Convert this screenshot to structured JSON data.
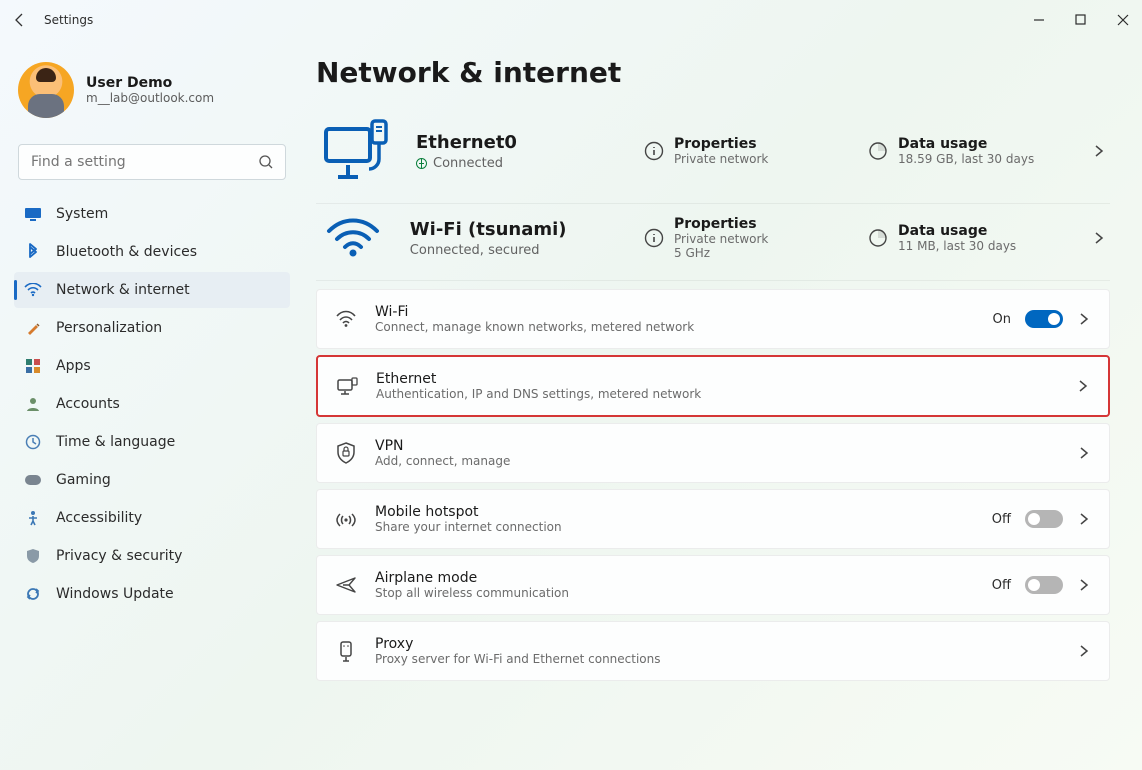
{
  "app": {
    "title": "Settings"
  },
  "user": {
    "name": "User Demo",
    "email": "m__lab@outlook.com"
  },
  "search": {
    "placeholder": "Find a setting"
  },
  "nav": [
    {
      "label": "System"
    },
    {
      "label": "Bluetooth & devices"
    },
    {
      "label": "Network & internet"
    },
    {
      "label": "Personalization"
    },
    {
      "label": "Apps"
    },
    {
      "label": "Accounts"
    },
    {
      "label": "Time & language"
    },
    {
      "label": "Gaming"
    },
    {
      "label": "Accessibility"
    },
    {
      "label": "Privacy & security"
    },
    {
      "label": "Windows Update"
    }
  ],
  "page": {
    "title": "Network & internet"
  },
  "connections": [
    {
      "name": "Ethernet0",
      "status": "Connected",
      "properties": {
        "head": "Properties",
        "sub": "Private network"
      },
      "usage": {
        "head": "Data usage",
        "sub": "18.59 GB, last 30 days"
      }
    },
    {
      "name": "Wi-Fi (tsunami)",
      "status": "Connected, secured",
      "properties": {
        "head": "Properties",
        "sub": "Private network\n5 GHz"
      },
      "usage": {
        "head": "Data usage",
        "sub": "11 MB, last 30 days"
      }
    }
  ],
  "cards": [
    {
      "title": "Wi-Fi",
      "sub": "Connect, manage known networks, metered network",
      "state": "On",
      "toggle": true
    },
    {
      "title": "Ethernet",
      "sub": "Authentication, IP and DNS settings, metered network"
    },
    {
      "title": "VPN",
      "sub": "Add, connect, manage"
    },
    {
      "title": "Mobile hotspot",
      "sub": "Share your internet connection",
      "state": "Off",
      "toggle": false
    },
    {
      "title": "Airplane mode",
      "sub": "Stop all wireless communication",
      "state": "Off",
      "toggle": false
    },
    {
      "title": "Proxy",
      "sub": "Proxy server for Wi-Fi and Ethernet connections"
    }
  ]
}
